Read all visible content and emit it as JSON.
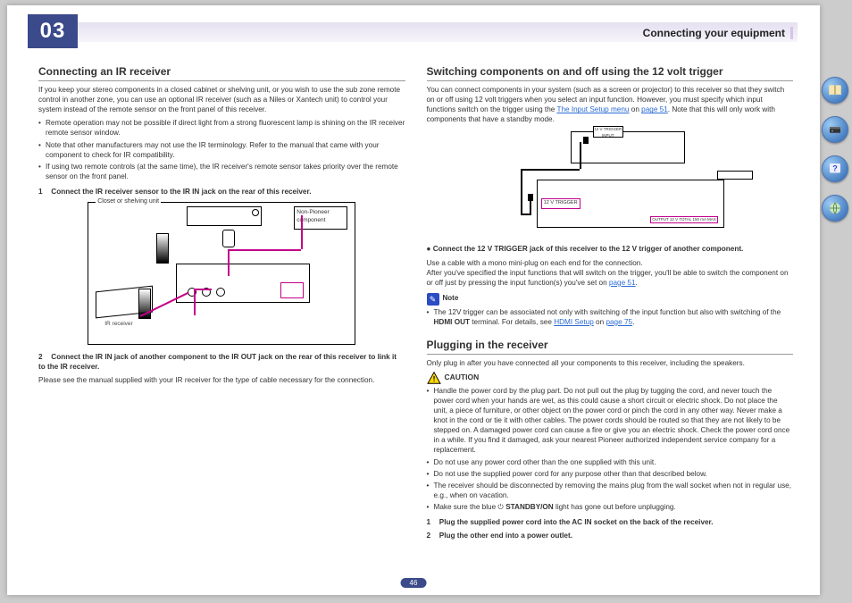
{
  "chapter_number": "03",
  "header_right": "Connecting your equipment",
  "page_number": "46",
  "left": {
    "h1": "Connecting an IR receiver",
    "intro": "If you keep your stereo components in a closed cabinet or shelving unit, or you wish to use the sub zone remote control in another zone, you can use an optional IR receiver (such as a Niles or Xantech unit) to control your system instead of the remote sensor on the front panel of this receiver.",
    "bullets": [
      "Remote operation may not be possible if direct light from a strong fluorescent lamp is shining on the IR receiver remote sensor window.",
      "Note that other manufacturers may not use the IR terminology. Refer to the manual that came with your component to check for IR compatibility.",
      "If using two remote controls (at the same time), the IR receiver's remote sensor takes priority over the remote sensor on the front panel."
    ],
    "step1_num": "1",
    "step1": "Connect the IR receiver sensor to the IR IN jack on the rear of this receiver.",
    "fig_label": "Closet or shelving unit",
    "np_label": "Non-Pioneer component",
    "ir_caption": "IR receiver",
    "step2_num": "2",
    "step2": "Connect the IR IN jack of another component to the IR OUT jack on the rear of this receiver to link it to the IR receiver.",
    "step2_after": "Please see the manual supplied with your IR receiver for the type of cable necessary for the connection."
  },
  "right": {
    "h1": "Switching components on and off using the 12 volt trigger",
    "intro_pre": "You can connect components in your system (such as a screen or projector) to this receiver so that they switch on or off using 12 volt triggers when you select an input function. However, you must specify which input functions switch on the trigger using the ",
    "intro_link": "The Input Setup menu",
    "intro_on": " on ",
    "intro_page": "page 51",
    "intro_post": ". Note that this will only work with components that have a standby mode.",
    "fig2_trig_in": "12 V TRIGGER INPUT",
    "fig2_trig_out": "12 V TRIGGER",
    "fig2_trig_spec": "OUTPUT 12 V\nTOTAL 150 mA MAX",
    "bullet_bold": "Connect the 12 V TRIGGER jack of this receiver to the 12 V trigger of another component.",
    "bullet_after": "Use a cable with a mono mini-plug on each end for the connection.",
    "after1": "After you've specified the input functions that will switch on the trigger, you'll be able to switch the component on or off just by pressing the input function(s) you've set on ",
    "after1_page": "page 51",
    "after1_post": ".",
    "note_label": "Note",
    "note_bul_pre": "The 12V trigger can be associated not only with switching of the input function but also with switching of the ",
    "note_bul_bold": "HDMI OUT",
    "note_bul_mid": " terminal. For details, see ",
    "note_bul_link": "HDMI Setup",
    "note_bul_on": " on ",
    "note_bul_page": "page 75",
    "note_bul_post": ".",
    "h2": "Plugging in the receiver",
    "h2_intro": "Only plug in after you have connected all your components to this receiver, including the speakers.",
    "caution_label": "CAUTION",
    "caution_bullets": [
      "Handle the power cord by the plug part. Do not pull out the plug by tugging the cord, and never touch the power cord when your hands are wet, as this could cause a short circuit or electric shock. Do not place the unit, a piece of furniture, or other object on the power cord or pinch the cord in any other way. Never make a knot in the cord or tie it with other cables. The power cords should be routed so that they are not likely to be stepped on. A damaged power cord can cause a fire or give you an electric shock. Check the power cord once in a while. If you find it damaged, ask your nearest Pioneer authorized independent service company for a replacement.",
      "Do not use any power cord other than the one supplied with this unit.",
      "Do not use the supplied power cord for any purpose other than that described below.",
      "The receiver should be disconnected by removing the mains plug from the wall socket when not in regular use, e.g., when on vacation."
    ],
    "caution_last_pre": "Make sure the blue ",
    "caution_last_sym": "⏻",
    "caution_last_bold": "STANDBY/ON",
    "caution_last_post": " light has gone out before unplugging.",
    "pstep1_num": "1",
    "pstep1": "Plug the supplied power cord into the AC IN socket on the back of the receiver.",
    "pstep2_num": "2",
    "pstep2": "Plug the other end into a power outlet."
  },
  "nav": {
    "book": "manual-icon",
    "device": "device-icon",
    "help": "help-icon",
    "network": "network-icon"
  }
}
